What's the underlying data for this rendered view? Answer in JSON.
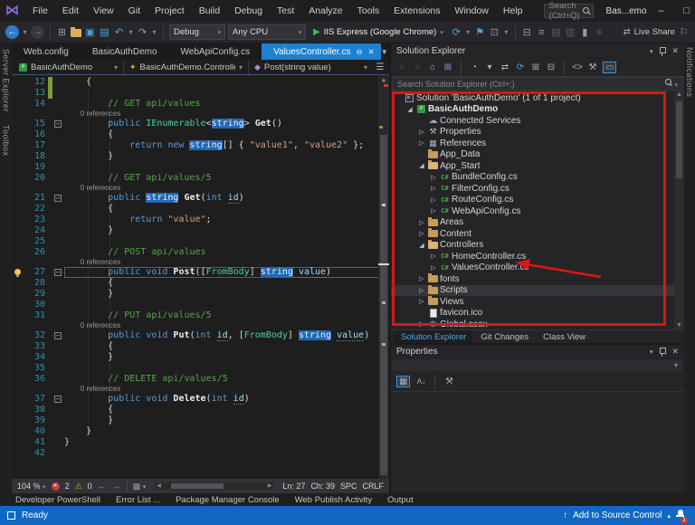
{
  "titlebar": {
    "menus": [
      "File",
      "Edit",
      "View",
      "Git",
      "Project",
      "Build",
      "Debug",
      "Test",
      "Analyze",
      "Tools",
      "Extensions",
      "Window",
      "Help"
    ],
    "search_placeholder": "Search (Ctrl+Q)",
    "window_title": "Bas...emo",
    "window_controls": [
      "minimize",
      "maximize",
      "close"
    ]
  },
  "toolbar": {
    "debug_config": "Debug",
    "platform": "Any CPU",
    "run_target": "IIS Express (Google Chrome)",
    "live_share_label": "Live Share",
    "icons": [
      "nav-back-icon",
      "nav-back-caret",
      "nav-forward-icon",
      "new-project-icon",
      "open-file-icon",
      "save-icon",
      "save-all-icon",
      "undo-icon",
      "undo-caret",
      "redo-icon",
      "redo-caret",
      "run-icon",
      "refresh-icon",
      "refresh-caret",
      "flag-icon",
      "browser-preview-icon",
      "preview-caret",
      "outline-icon",
      "indent-icon",
      "comment-icon",
      "uncomment-icon",
      "bookmark-icon",
      "overflow-icon",
      "live-share-icon",
      "feedback-icon"
    ]
  },
  "left_strip": {
    "tabs": [
      "Server Explorer",
      "Toolbox"
    ]
  },
  "right_strip": {
    "tabs": [
      "Notifications"
    ]
  },
  "doc_tabs": [
    {
      "label": "Web.config",
      "active": false
    },
    {
      "label": "BasicAuthDemo",
      "active": false
    },
    {
      "label": "WebApiConfig.cs",
      "active": false
    },
    {
      "label": "ValuesController.cs",
      "active": true
    }
  ],
  "navbar": {
    "project": "BasicAuthDemo",
    "type": "BasicAuthDemo.Controllers.\\",
    "member": "Post(string value)"
  },
  "editor": {
    "lines": [
      {
        "n": 12,
        "chg": true,
        "t": [
          [
            "plain",
            "    {"
          ]
        ]
      },
      {
        "n": 13,
        "chg": true,
        "t": []
      },
      {
        "n": 14,
        "t": [
          [
            "cmt",
            "        // GET api/values"
          ]
        ]
      },
      {
        "cl": "        0 references"
      },
      {
        "n": 15,
        "fold": true,
        "t": [
          [
            "kw",
            "        public "
          ],
          [
            "type",
            "IEnumerable"
          ],
          [
            "plain",
            "<"
          ],
          [
            "hl",
            "string"
          ],
          [
            "plain",
            "> "
          ],
          [
            "method",
            "Get"
          ],
          [
            "plain",
            "()"
          ]
        ]
      },
      {
        "n": 16,
        "t": [
          [
            "plain",
            "        {"
          ]
        ]
      },
      {
        "n": 17,
        "t": [
          [
            "kw",
            "            return "
          ],
          [
            "kw",
            "new "
          ],
          [
            "hl",
            "string"
          ],
          [
            "plain",
            "[] { "
          ],
          [
            "str",
            "\"value1\""
          ],
          [
            "plain",
            ", "
          ],
          [
            "str",
            "\"value2\""
          ],
          [
            "plain",
            " };"
          ]
        ]
      },
      {
        "n": 18,
        "t": [
          [
            "plain",
            "        }"
          ]
        ]
      },
      {
        "n": 19,
        "t": []
      },
      {
        "n": 20,
        "t": [
          [
            "cmt",
            "        // GET api/values/5"
          ]
        ]
      },
      {
        "cl": "        0 references"
      },
      {
        "n": 21,
        "fold": true,
        "t": [
          [
            "kw",
            "        public "
          ],
          [
            "hl",
            "string"
          ],
          [
            "plain",
            " "
          ],
          [
            "method",
            "Get"
          ],
          [
            "plain",
            "("
          ],
          [
            "kw",
            "int"
          ],
          [
            "plain",
            " "
          ],
          [
            "param",
            "id"
          ],
          [
            "plain",
            ")"
          ]
        ]
      },
      {
        "n": 22,
        "t": [
          [
            "plain",
            "        {"
          ]
        ]
      },
      {
        "n": 23,
        "t": [
          [
            "kw",
            "            return "
          ],
          [
            "str",
            "\"value\""
          ],
          [
            "plain",
            ";"
          ]
        ]
      },
      {
        "n": 24,
        "t": [
          [
            "plain",
            "        }"
          ]
        ]
      },
      {
        "n": 25,
        "t": []
      },
      {
        "n": 26,
        "t": [
          [
            "cmt",
            "        // POST api/values"
          ]
        ]
      },
      {
        "cl": "        0 references"
      },
      {
        "n": 27,
        "fold": true,
        "cur": true,
        "bulb": true,
        "t": [
          [
            "kw",
            "        public void "
          ],
          [
            "method",
            "Post"
          ],
          [
            "plain",
            "(["
          ],
          [
            "type",
            "FromBody"
          ],
          [
            "plain",
            "] "
          ],
          [
            "hl",
            "string"
          ],
          [
            "plain",
            " "
          ],
          [
            "param",
            "value"
          ],
          [
            "plain",
            ")"
          ]
        ]
      },
      {
        "n": 28,
        "t": [
          [
            "plain",
            "        {"
          ]
        ]
      },
      {
        "n": 29,
        "t": [
          [
            "plain",
            "        }"
          ]
        ]
      },
      {
        "n": 30,
        "t": []
      },
      {
        "n": 31,
        "t": [
          [
            "cmt",
            "        // PUT api/values/5"
          ]
        ]
      },
      {
        "cl": "        0 references"
      },
      {
        "n": 32,
        "fold": true,
        "t": [
          [
            "kw",
            "        public void "
          ],
          [
            "method",
            "Put"
          ],
          [
            "plain",
            "("
          ],
          [
            "kw",
            "int"
          ],
          [
            "plain",
            " "
          ],
          [
            "param",
            "id"
          ],
          [
            "plain",
            ", ["
          ],
          [
            "type",
            "FromBody"
          ],
          [
            "plain",
            "] "
          ],
          [
            "hl",
            "string"
          ],
          [
            "plain",
            " "
          ],
          [
            "param",
            "value"
          ],
          [
            "plain",
            ")"
          ]
        ]
      },
      {
        "n": 33,
        "t": [
          [
            "plain",
            "        {"
          ]
        ]
      },
      {
        "n": 34,
        "t": [
          [
            "plain",
            "        }"
          ]
        ]
      },
      {
        "n": 35,
        "t": []
      },
      {
        "n": 36,
        "t": [
          [
            "cmt",
            "        // DELETE api/values/5"
          ]
        ]
      },
      {
        "cl": "        0 references"
      },
      {
        "n": 37,
        "fold": true,
        "t": [
          [
            "kw",
            "        public void "
          ],
          [
            "method",
            "Delete"
          ],
          [
            "plain",
            "("
          ],
          [
            "kw",
            "int"
          ],
          [
            "plain",
            " "
          ],
          [
            "param",
            "id"
          ],
          [
            "plain",
            ")"
          ]
        ]
      },
      {
        "n": 38,
        "t": [
          [
            "plain",
            "        {"
          ]
        ]
      },
      {
        "n": 39,
        "t": [
          [
            "plain",
            "        }"
          ]
        ]
      },
      {
        "n": 40,
        "t": [
          [
            "plain",
            "    }"
          ]
        ]
      },
      {
        "n": 41,
        "t": [
          [
            "plain",
            "}"
          ]
        ]
      },
      {
        "n": 42,
        "t": []
      }
    ]
  },
  "editor_status": {
    "zoom": "104 %",
    "errors": "2",
    "warnings": "0",
    "line": "Ln: 27",
    "char": "Ch: 39",
    "spc": "SPC",
    "eol": "CRLF"
  },
  "solution_explorer": {
    "title": "Solution Explorer",
    "search_placeholder": "Search Solution Explorer (Ctrl+;)",
    "toolbar_icons": [
      "back-circle-icon",
      "forward-circle-icon",
      "home-icon",
      "switch-views-icon",
      "pending-changes-icon",
      "pending-caret",
      "sync-icon",
      "refresh-icon",
      "nest-files-icon",
      "collapse-all-icon",
      "view-code-icon",
      "properties-wrench-icon",
      "preview-toggle-icon"
    ],
    "tree": [
      {
        "d": 0,
        "ic": "sol",
        "label": "Solution 'BasicAuthDemo' (1 of 1 project)"
      },
      {
        "d": 1,
        "ic": "proj",
        "label": "BasicAuthDemo",
        "ex": "e",
        "b": true
      },
      {
        "d": 2,
        "ic": "cloud",
        "label": "Connected Services"
      },
      {
        "d": 2,
        "ic": "wrench",
        "label": "Properties",
        "ex": "c"
      },
      {
        "d": 2,
        "ic": "refs",
        "label": "References",
        "ex": "c"
      },
      {
        "d": 2,
        "ic": "folder",
        "label": "App_Data"
      },
      {
        "d": 2,
        "ic": "folder-open",
        "label": "App_Start",
        "ex": "e"
      },
      {
        "d": 3,
        "ic": "cs",
        "label": "BundleConfig.cs",
        "ex": "c"
      },
      {
        "d": 3,
        "ic": "cs",
        "label": "FilterConfig.cs",
        "ex": "c"
      },
      {
        "d": 3,
        "ic": "cs",
        "label": "RouteConfig.cs",
        "ex": "c"
      },
      {
        "d": 3,
        "ic": "cs",
        "label": "WebApiConfig.cs",
        "ex": "c"
      },
      {
        "d": 2,
        "ic": "folder",
        "label": "Areas",
        "ex": "c"
      },
      {
        "d": 2,
        "ic": "folder",
        "label": "Content",
        "ex": "c"
      },
      {
        "d": 2,
        "ic": "folder-open",
        "label": "Controllers",
        "ex": "e"
      },
      {
        "d": 3,
        "ic": "cs",
        "label": "HomeController.cs",
        "ex": "c"
      },
      {
        "d": 3,
        "ic": "cs",
        "label": "ValuesController.cs",
        "ex": "c",
        "arrow": true
      },
      {
        "d": 2,
        "ic": "folder",
        "label": "fonts",
        "ex": "c"
      },
      {
        "d": 2,
        "ic": "folder",
        "label": "Scripts",
        "ex": "c",
        "sel": true
      },
      {
        "d": 2,
        "ic": "folder",
        "label": "Views",
        "ex": "c"
      },
      {
        "d": 2,
        "ic": "file",
        "label": "favicon.ico"
      },
      {
        "d": 2,
        "ic": "globe",
        "label": "Global.asax",
        "ex": "c"
      }
    ]
  },
  "panel_tabs": [
    {
      "label": "Solution Explorer",
      "active": true
    },
    {
      "label": "Git Changes",
      "active": false
    },
    {
      "label": "Class View",
      "active": false
    }
  ],
  "properties_panel": {
    "title": "Properties",
    "toolbar_icons": [
      "categorized-icon",
      "alphabetical-sort-icon",
      "property-pages-icon"
    ]
  },
  "bottom_tabs": [
    "Developer PowerShell",
    "Error List ...",
    "Package Manager Console",
    "Web Publish Activity",
    "Output"
  ],
  "statusbar": {
    "ready": "Ready",
    "source_control": "Add to Source Control",
    "notification_count": "1"
  },
  "annotation_colors": {
    "red": "#D81717",
    "accent_blue": "#1C81D1",
    "status_blue": "#1168C2"
  }
}
